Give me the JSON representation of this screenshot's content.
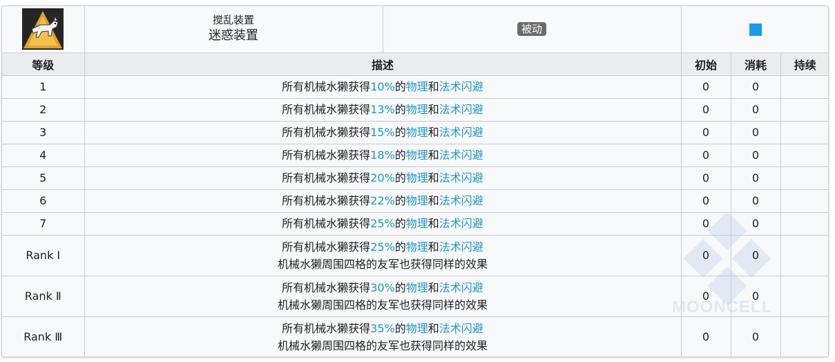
{
  "skill": {
    "icon": "dog-icon",
    "category": "搅乱装置",
    "name": "迷惑装置",
    "type_tag": "被动",
    "indicator_color": "#1a9ce8"
  },
  "headers": {
    "level": "等级",
    "description": "描述",
    "initial": "初始",
    "cost": "消耗",
    "duration": "持续"
  },
  "rows": [
    {
      "level": "1",
      "d1a": "所有机械水獭获得",
      "pct": "10%",
      "d1b": "的",
      "k1": "物理",
      "d1c": "和",
      "k2": "法术闪避",
      "d2": "",
      "initial": "0",
      "cost": "0",
      "duration": ""
    },
    {
      "level": "2",
      "d1a": "所有机械水獭获得",
      "pct": "13%",
      "d1b": "的",
      "k1": "物理",
      "d1c": "和",
      "k2": "法术闪避",
      "d2": "",
      "initial": "0",
      "cost": "0",
      "duration": ""
    },
    {
      "level": "3",
      "d1a": "所有机械水獭获得",
      "pct": "15%",
      "d1b": "的",
      "k1": "物理",
      "d1c": "和",
      "k2": "法术闪避",
      "d2": "",
      "initial": "0",
      "cost": "0",
      "duration": ""
    },
    {
      "level": "4",
      "d1a": "所有机械水獭获得",
      "pct": "18%",
      "d1b": "的",
      "k1": "物理",
      "d1c": "和",
      "k2": "法术闪避",
      "d2": "",
      "initial": "0",
      "cost": "0",
      "duration": ""
    },
    {
      "level": "5",
      "d1a": "所有机械水獭获得",
      "pct": "20%",
      "d1b": "的",
      "k1": "物理",
      "d1c": "和",
      "k2": "法术闪避",
      "d2": "",
      "initial": "0",
      "cost": "0",
      "duration": ""
    },
    {
      "level": "6",
      "d1a": "所有机械水獭获得",
      "pct": "22%",
      "d1b": "的",
      "k1": "物理",
      "d1c": "和",
      "k2": "法术闪避",
      "d2": "",
      "initial": "0",
      "cost": "0",
      "duration": ""
    },
    {
      "level": "7",
      "d1a": "所有机械水獭获得",
      "pct": "25%",
      "d1b": "的",
      "k1": "物理",
      "d1c": "和",
      "k2": "法术闪避",
      "d2": "",
      "initial": "0",
      "cost": "0",
      "duration": ""
    },
    {
      "level": "Rank Ⅰ",
      "d1a": "所有机械水獭获得",
      "pct": "25%",
      "d1b": "的",
      "k1": "物理",
      "d1c": "和",
      "k2": "法术闪避",
      "d2": "机械水獭周围四格的友军也获得同样的效果",
      "initial": "0",
      "cost": "0",
      "duration": ""
    },
    {
      "level": "Rank Ⅱ",
      "d1a": "所有机械水獭获得",
      "pct": "30%",
      "d1b": "的",
      "k1": "物理",
      "d1c": "和",
      "k2": "法术闪避",
      "d2": "机械水獭周围四格的友军也获得同样的效果",
      "initial": "0",
      "cost": "0",
      "duration": ""
    },
    {
      "level": "Rank Ⅲ",
      "d1a": "所有机械水獭获得",
      "pct": "35%",
      "d1b": "的",
      "k1": "物理",
      "d1c": "和",
      "k2": "法术闪避",
      "d2": "机械水獭周围四格的友军也获得同样的效果",
      "initial": "0",
      "cost": "0",
      "duration": ""
    }
  ],
  "watermark": {
    "text": "MOONCELL",
    "icon": "mooncell-logo-icon"
  }
}
